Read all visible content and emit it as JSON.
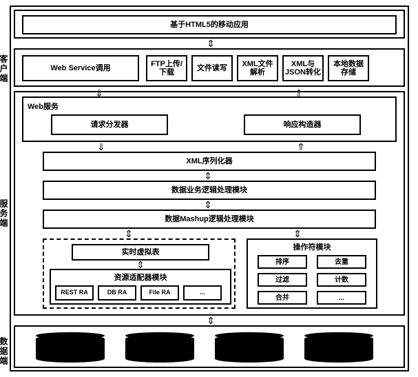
{
  "tiers": {
    "client": {
      "label": "客户端"
    },
    "server": {
      "label": "服务端"
    },
    "data": {
      "label": "数据端"
    }
  },
  "client": {
    "app_title": "基于HTML5的移动应用",
    "web_service": "Web Service调用",
    "ftp": "FTP上传/下载",
    "file_rw": "文件读写",
    "xml_parse": "XML文件解析",
    "xml_json": "XML与JSON转化",
    "local_store": "本地数据存储"
  },
  "server": {
    "web_service_group": "Web服务",
    "dispatcher": "请求分发器",
    "responder": "响应构造器",
    "xml_serializer": "XML序列化器",
    "biz_logic": "数据业务逻辑处理模块",
    "mashup": "数据Mashup逻辑处理模块",
    "vtable": "实时虚拟表",
    "ra_module": "资源适配器模块",
    "ra_rest": "REST RA",
    "ra_db": "DB RA",
    "ra_file": "File RA",
    "ra_more": "...",
    "op_module": "操作符模块",
    "op_sort": "排序",
    "op_dedup": "去重",
    "op_filter": "过滤",
    "op_count": "计数",
    "op_merge": "合并",
    "op_more": "..."
  }
}
